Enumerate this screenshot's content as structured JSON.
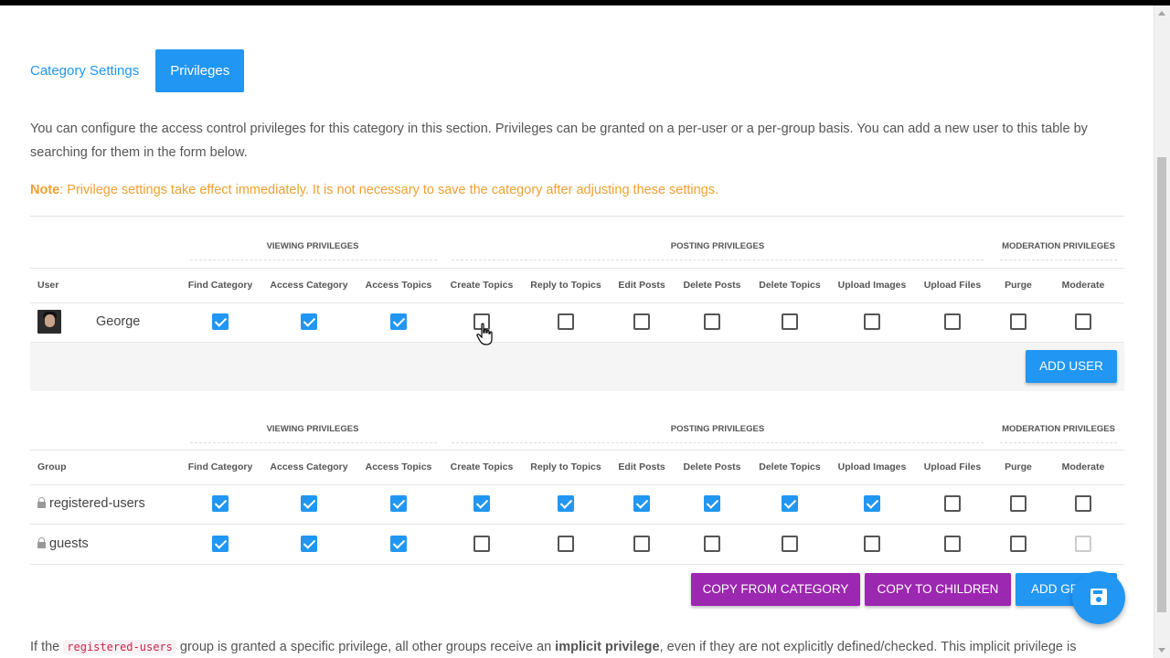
{
  "tabs": {
    "category_settings": "Category Settings",
    "privileges": "Privileges"
  },
  "intro_text": "You can configure the access control privileges for this category in this section. Privileges can be granted on a per-user or a per-group basis. You can add a new user to this table by searching for them in the form below.",
  "note": {
    "label": "Note",
    "text": ": Privilege settings take effect immediately. It is not necessary to save the category after adjusting these settings."
  },
  "groups_header": {
    "viewing": "VIEWING PRIVILEGES",
    "posting": "POSTING PRIVILEGES",
    "moderation": "MODERATION PRIVILEGES"
  },
  "columns": [
    "Find Category",
    "Access Category",
    "Access Topics",
    "Create Topics",
    "Reply to Topics",
    "Edit Posts",
    "Delete Posts",
    "Delete Topics",
    "Upload Images",
    "Upload Files",
    "Purge",
    "Moderate"
  ],
  "user_table": {
    "first_header": "User",
    "rows": [
      {
        "name": "George",
        "values": [
          true,
          true,
          true,
          false,
          false,
          false,
          false,
          false,
          false,
          false,
          false,
          false
        ]
      }
    ],
    "add_button": "ADD USER"
  },
  "group_table": {
    "first_header": "Group",
    "rows": [
      {
        "name": "registered-users",
        "values": [
          true,
          true,
          true,
          true,
          true,
          true,
          true,
          true,
          true,
          false,
          false,
          false
        ]
      },
      {
        "name": "guests",
        "values": [
          true,
          true,
          true,
          false,
          false,
          false,
          false,
          false,
          false,
          false,
          false,
          false
        ]
      }
    ],
    "buttons": {
      "copy_from_category": "COPY FROM CATEGORY",
      "copy_to_children": "COPY TO CHILDREN",
      "add_group": "ADD GR"
    }
  },
  "bottom": {
    "prefix": "If the ",
    "code": "registered-users",
    "middle": " group is granted a specific privilege, all other groups receive an ",
    "bold": "implicit privilege",
    "suffix": ", even if they are not explicitly defined/checked. This implicit privilege is"
  },
  "colors": {
    "accent": "#2196f3",
    "purple": "#9c27b0",
    "note": "#f0a030"
  },
  "icons": {
    "save_fab": "floppy-disk-icon",
    "lock": "lock-icon"
  }
}
